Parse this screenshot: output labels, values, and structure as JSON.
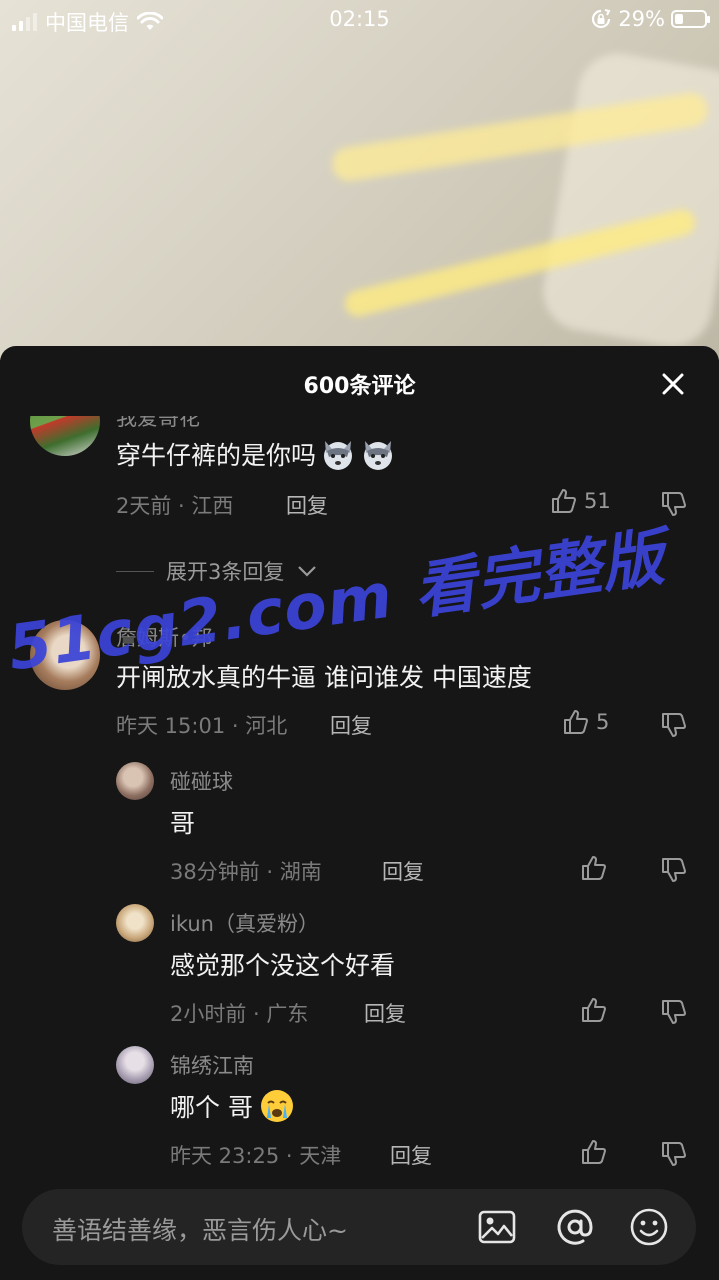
{
  "status_bar": {
    "carrier": "中国电信",
    "time": "02:15",
    "battery_percent": "29%",
    "battery_level": 0.29
  },
  "sheet": {
    "title": "600条评论"
  },
  "comments": [
    {
      "name": "我爱哥花",
      "text": "穿牛仔裤的是你吗",
      "emojis": [
        "wolf-emoji",
        "wolf-emoji"
      ],
      "time_location": "2天前 · 江西",
      "reply_label": "回复",
      "likes": "51",
      "expand_label": "展开3条回复",
      "replies": []
    },
    {
      "name": "詹姆斯•邦",
      "text": "开闸放水真的牛逼   谁问谁发  中国速度",
      "time_location": "昨天 15:01 · 河北",
      "reply_label": "回复",
      "likes": "5",
      "replies": [
        {
          "name": "碰碰球",
          "text": "哥",
          "time_location": "38分钟前 · 湖南",
          "reply_label": "回复",
          "likes": ""
        },
        {
          "name": "ikun（真爱粉）",
          "text": "感觉那个没这个好看",
          "time_location": "2小时前 · 广东",
          "reply_label": "回复",
          "likes": ""
        },
        {
          "name": "锦绣江南",
          "text": "哪个 哥",
          "emoji": "crying-emoji",
          "time_location": "昨天 23:25 · 天津",
          "reply_label": "回复",
          "likes": ""
        }
      ]
    }
  ],
  "watermark": "51cg2.com 看完整版",
  "input": {
    "placeholder": "善语结善缘，恶言伤人心~"
  },
  "icons": [
    "signal-icon",
    "wifi-icon",
    "rotation-lock-icon",
    "battery-icon",
    "close-icon",
    "thumbs-up-icon",
    "thumbs-down-icon",
    "chevron-down-icon",
    "image-icon",
    "at-icon",
    "emoji-icon"
  ],
  "colors": {
    "sheet_bg": "#161616",
    "watermark": "#3b44d8",
    "text_primary": "#f2f2f2",
    "text_secondary": "#8a8a8a"
  }
}
